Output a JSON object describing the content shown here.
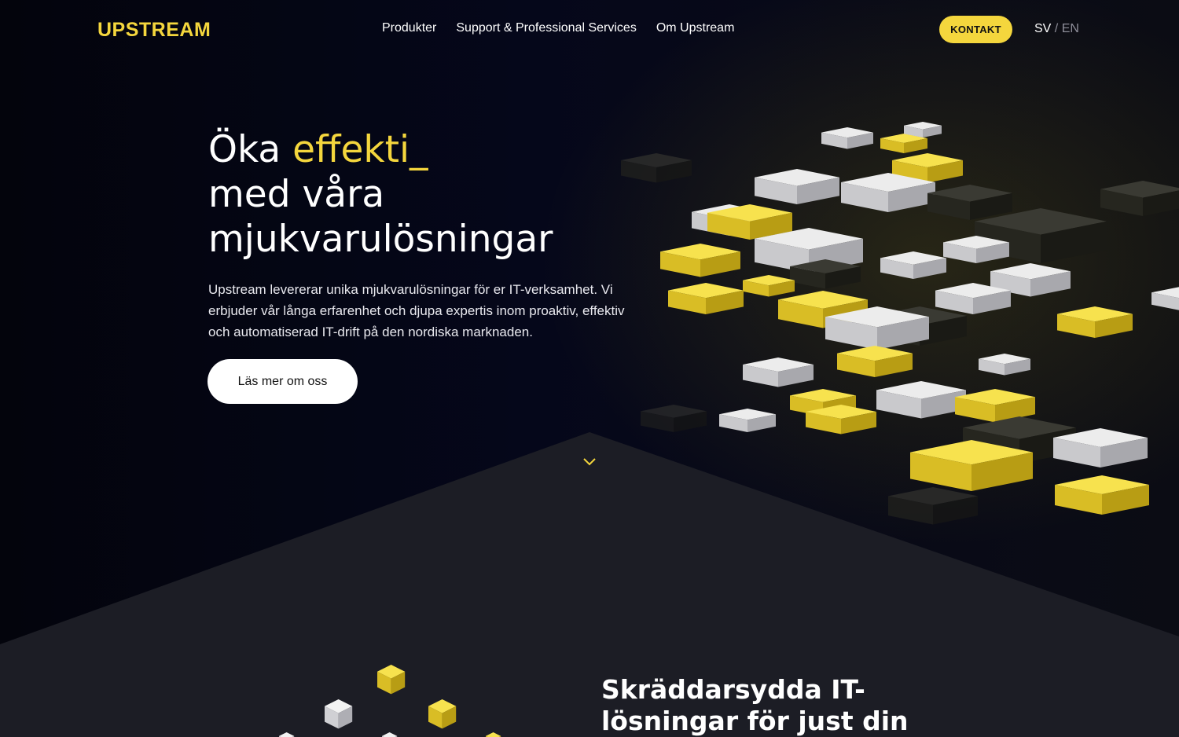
{
  "brand": {
    "logo": "UPSTREAM"
  },
  "nav": {
    "items": [
      {
        "label": "Produkter"
      },
      {
        "label": "Support & Professional Services"
      },
      {
        "label": "Om Upstream"
      }
    ],
    "cta_label": "KONTAKT",
    "lang_current": "SV",
    "lang_separator": " / ",
    "lang_other": "EN"
  },
  "hero": {
    "headline_word1": "Öka ",
    "headline_accent": "effekti_",
    "headline_line2": "med våra",
    "headline_line3": "mjukvarulösningar",
    "lead": "Upstream levererar unika mjukvarulösningar för er IT-verksamhet. Vi erbjuder vår långa erfarenhet och djupa expertis inom proaktiv, effektiv och automatiserad IT-drift på den nordiska marknaden.",
    "button_label": "Läs mer om oss"
  },
  "section2": {
    "headline": "Skräddarsydda IT-lösningar för just din"
  },
  "colors": {
    "accent": "#f4d63d",
    "background": "#05060f",
    "panel": "#1c1d25",
    "button_bg": "#ffffff"
  },
  "icons": {
    "scroll": "chevron-down-icon",
    "decor": "isometric-blocks"
  }
}
